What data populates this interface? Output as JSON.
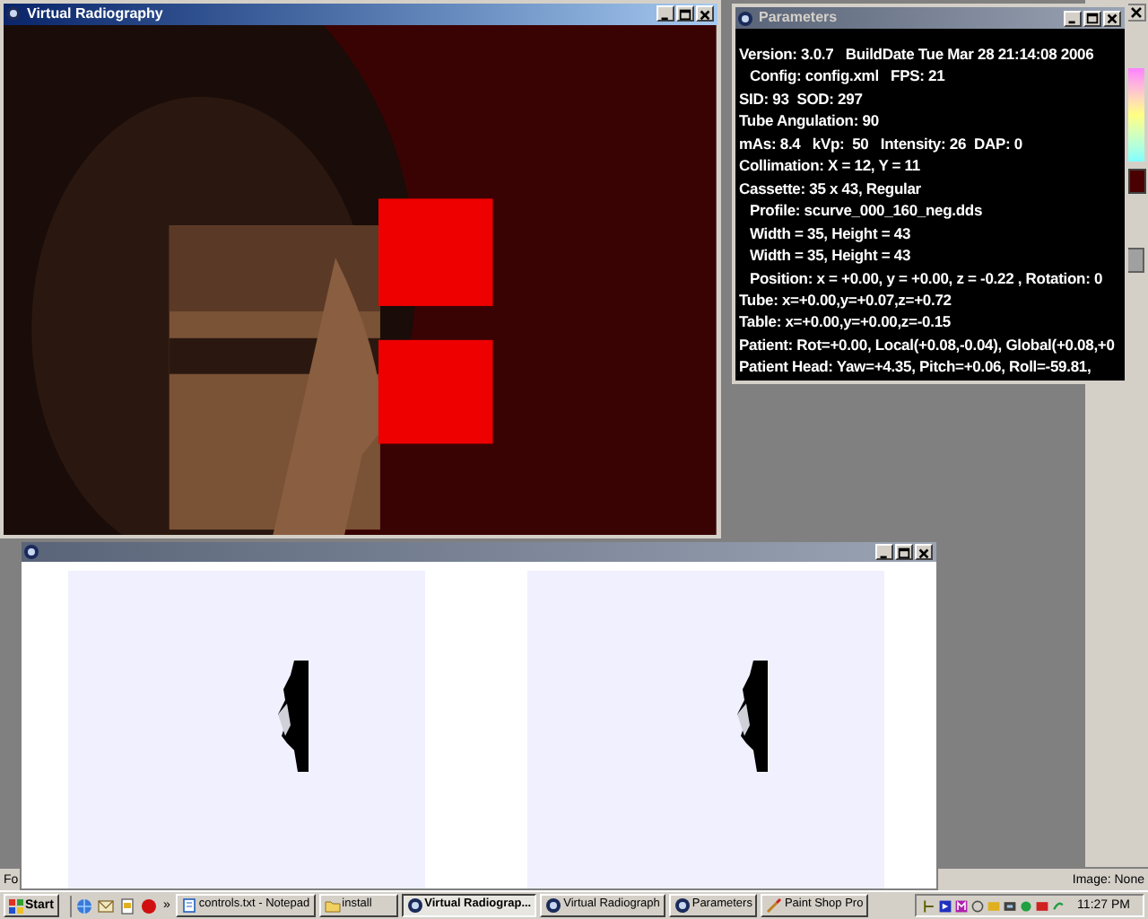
{
  "paint_shop": {
    "status_left": "Fo",
    "status_right": "Image: None"
  },
  "render_window": {
    "title": "Virtual Radiography",
    "active": true
  },
  "parameters_window": {
    "title": "Parameters",
    "active": false,
    "lines": [
      {
        "text": "Version: 3.0.7   BuildDate Tue Mar 28 21:14:08 2006",
        "kind": "plain"
      },
      {
        "text": "Config: config.xml   FPS: 21",
        "kind": "sub"
      },
      {
        "text": "SID: 93  SOD: 297",
        "kind": "plain"
      },
      {
        "text": "Tube Angulation: 90",
        "kind": "plain"
      },
      {
        "text": "mAs: 8.4   kVp:  50   Intensity: 26  DAP: 0",
        "kind": "plain"
      },
      {
        "text": "Collimation: X = 12, Y = 11",
        "kind": "plain"
      },
      {
        "text": "Cassette: 35 x 43, Regular",
        "kind": "plain"
      },
      {
        "text": "Profile: scurve_000_160_neg.dds",
        "kind": "sub"
      },
      {
        "text": "Width = 35, Height = 43",
        "kind": "sub"
      },
      {
        "text": "Width = 35, Height = 43",
        "kind": "sub"
      },
      {
        "text": "Position: x = +0.00, y = +0.00, z = -0.22 , Rotation: 0",
        "kind": "sub"
      },
      {
        "text": "Tube: x=+0.00,y=+0.07,z=+0.72",
        "kind": "plain"
      },
      {
        "text": "Table: x=+0.00,y=+0.00,z=-0.15",
        "kind": "plain"
      },
      {
        "text": "Patient: Rot=+0.00, Local(+0.08,-0.04), Global(+0.08,+0",
        "kind": "plain"
      },
      {
        "text": "Patient Head: Yaw=+4.35, Pitch=+0.06, Roll=-59.81,",
        "kind": "plain"
      }
    ]
  },
  "radiograph_window": {
    "active": false
  },
  "taskbar": {
    "start": "Start",
    "overflow": "»",
    "buttons": [
      {
        "label": "controls.txt - Notepad",
        "selected": false
      },
      {
        "label": "install",
        "selected": false
      },
      {
        "label": "Virtual Radiograp...",
        "selected": true
      },
      {
        "label": "Virtual Radiograph",
        "selected": false
      },
      {
        "label": "Parameters",
        "selected": false
      },
      {
        "label": "Paint Shop Pro",
        "selected": false
      }
    ],
    "clock": "11:27 PM"
  }
}
